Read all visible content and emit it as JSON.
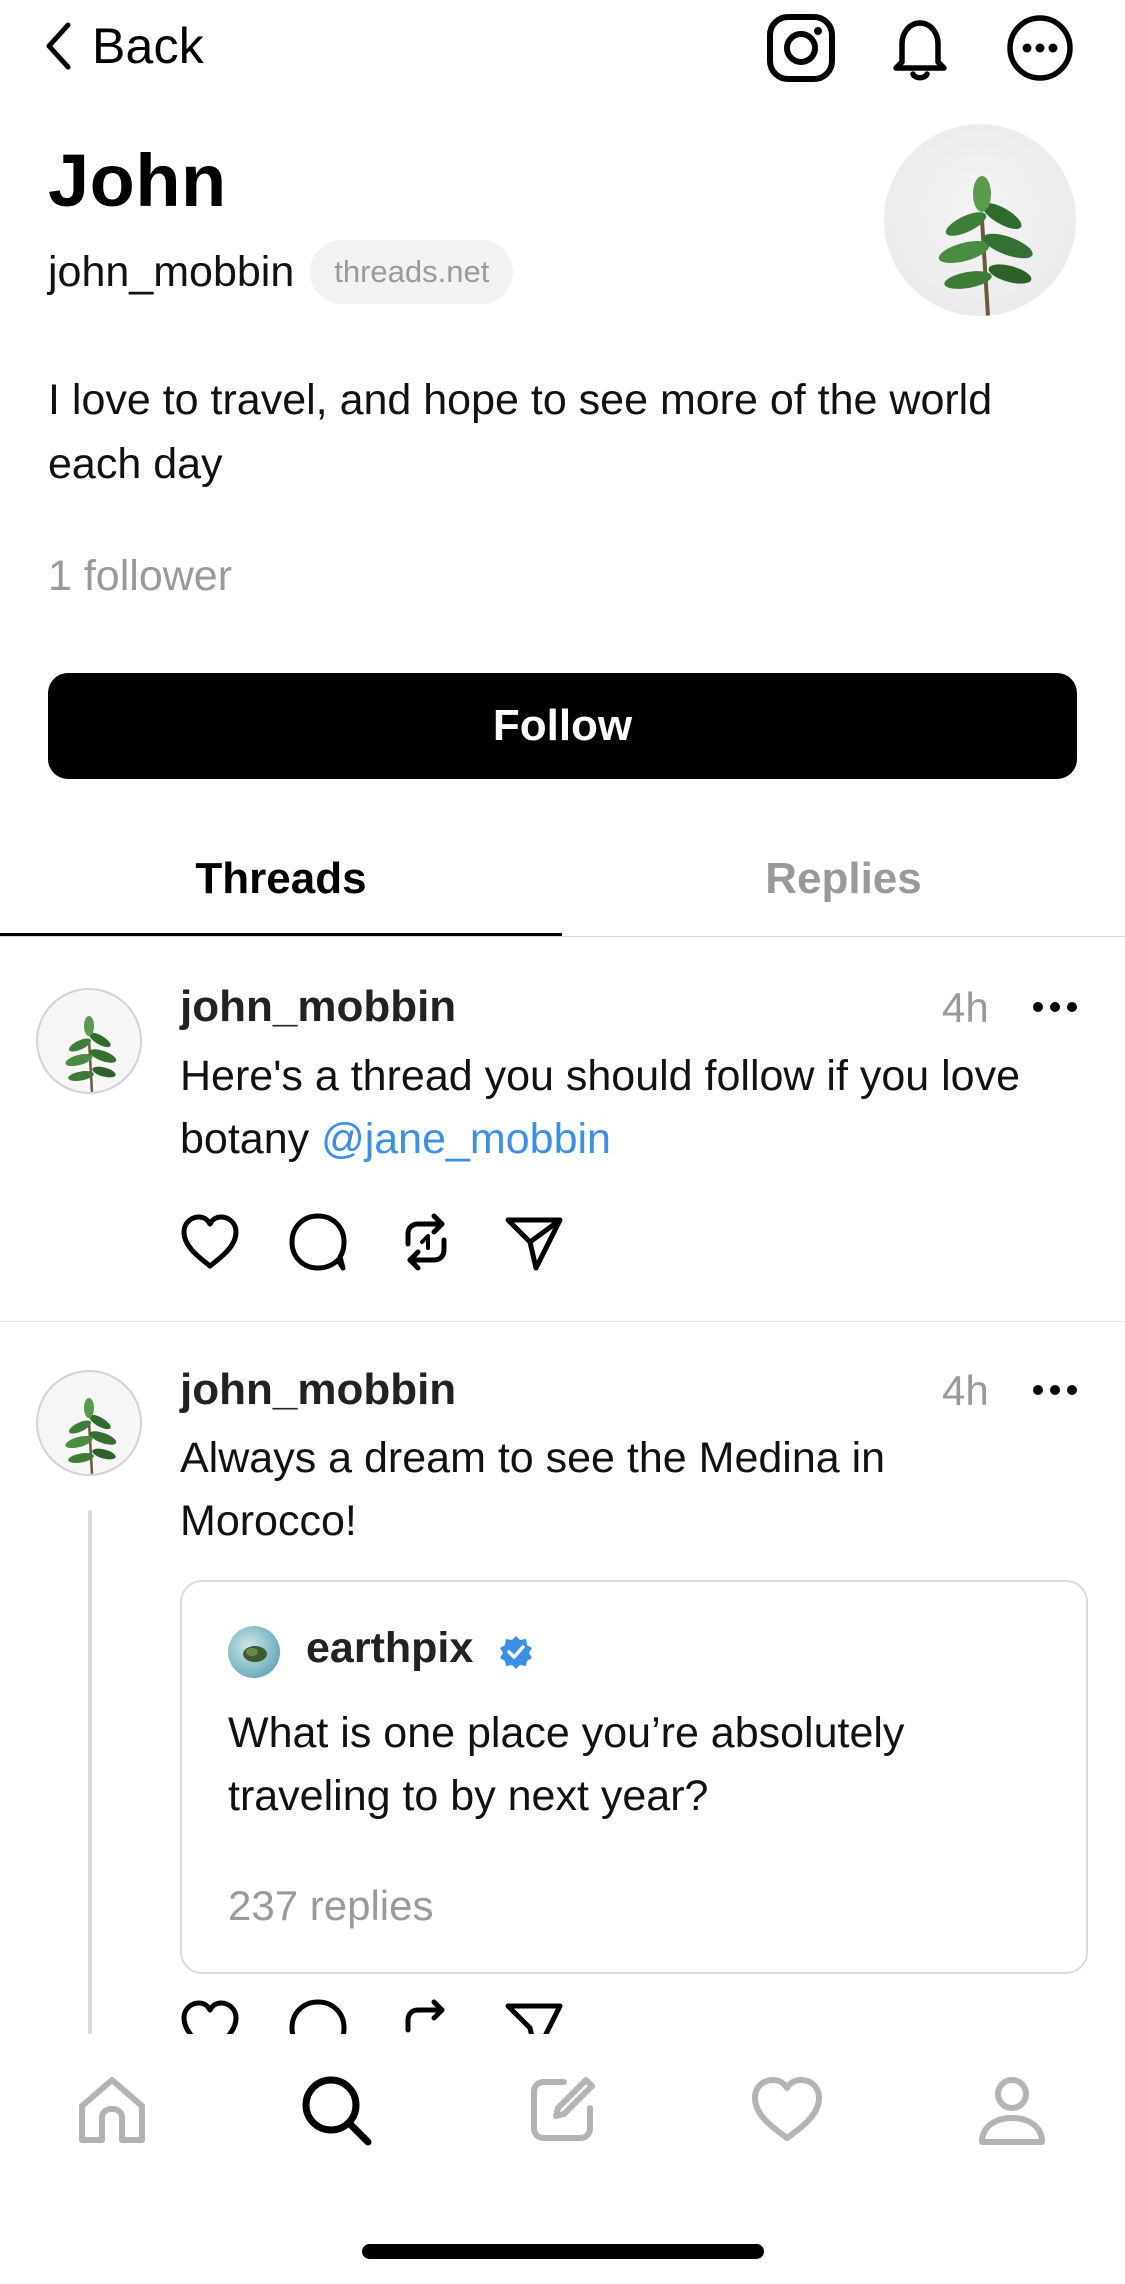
{
  "top_bar": {
    "back_label": "Back",
    "icons": [
      "instagram-icon",
      "bell-icon",
      "more-options-icon"
    ]
  },
  "profile": {
    "name": "John",
    "handle": "john_mobbin",
    "domain_chip": "threads.net",
    "bio": "I love to travel, and hope to see more of the world each day",
    "followers": "1 follower",
    "follow_label": "Follow"
  },
  "tabs": [
    {
      "label": "Threads",
      "active": true
    },
    {
      "label": "Replies",
      "active": false
    }
  ],
  "posts": [
    {
      "user": "john_mobbin",
      "time": "4h",
      "text": "Here's a thread you should follow if you love botany ",
      "mention": "@jane_mobbin"
    },
    {
      "user": "john_mobbin",
      "time": "4h",
      "text": "Always a dream to see the Medina in Morocco!",
      "quote": {
        "user": "earthpix",
        "verified": true,
        "text": "What is one place you’re absolutely traveling to by next year?",
        "replies": "237 replies"
      }
    }
  ],
  "nav": {
    "items": [
      "home-icon",
      "search-icon",
      "compose-icon",
      "activity-heart-icon",
      "profile-icon"
    ],
    "active": "search-icon"
  },
  "colors": {
    "accent_link": "#3d8fe6",
    "muted_text": "#999999",
    "verified_badge": "#3d8fe6",
    "button_bg": "#000000"
  }
}
